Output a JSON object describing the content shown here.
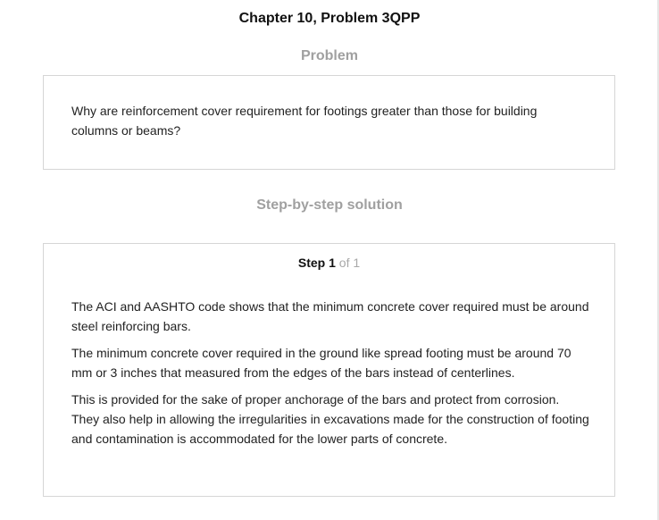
{
  "page": {
    "title": "Chapter 10, Problem 3QPP"
  },
  "problem": {
    "heading": "Problem",
    "text": "Why are reinforcement cover requirement for footings greater than those for building columns or beams?"
  },
  "solution": {
    "heading": "Step-by-step solution",
    "step_word": "Step",
    "step_number": "1",
    "step_of": "of 1",
    "paragraphs": [
      "The ACI and AASHTO code shows that the minimum concrete cover required must be around steel reinforcing bars.",
      "The minimum concrete cover required in the ground like spread footing must be around 70 mm or 3 inches that measured from the edges of the bars instead of centerlines.",
      "This is provided for the sake of proper anchorage of the bars and protect from corrosion. They also help in allowing the irregularities in excavations made for the construction of footing and contamination is accommodated for the lower parts of concrete."
    ]
  }
}
